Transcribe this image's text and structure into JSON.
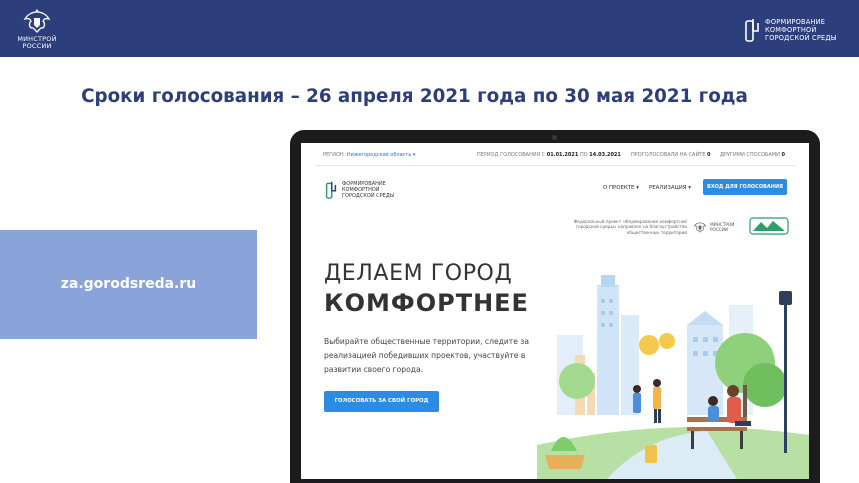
{
  "header": {
    "ministry_logo_lines": [
      "МИНСТРОЙ",
      "РОССИИ"
    ],
    "project_logo_lines": [
      "ФОРМИРОВАНИЕ",
      "КОМФОРТНОЙ",
      "ГОРОДСКОЙ СРЕДЫ"
    ]
  },
  "headline": "Сроки голосования – 26 апреля 2021 года по 30 мая 2021 года",
  "url_box": {
    "url": "za.gorodsreda.ru",
    "color": "#8aa3d9"
  },
  "site": {
    "region_label": "РЕГИОН",
    "region_value": "Нижегородская область",
    "period_label": "ПЕРИОД ГОЛОСОВАНИЯ С",
    "period_from": "01.01.2021",
    "period_to_label": "ПО",
    "period_to": "14.03.2021",
    "voted_label": "ПРОГОЛОСОВАЛИ НА САЙТЕ",
    "voted_value": "0",
    "others_label": "ДРУГИМИ СПОСОБАМИ",
    "others_value": "0",
    "logo_lines": [
      "ФОРМИРОВАНИЕ",
      "КОМФОРТНОЙ",
      "ГОРОДСКОЙ СРЕДЫ"
    ],
    "nav": [
      "О ПРОЕКТЕ",
      "РЕАЛИЗАЦИЯ"
    ],
    "login_button": "ВХОД ДЛЯ ГОЛОСОВАНИЯ",
    "federal_note": [
      "Федеральный проект «Формирование комфортной",
      "городской среды» направлен на благоустройство",
      "общественных территорий"
    ],
    "ministry_lines": [
      "МИНСТРОЙ",
      "РОССИИ"
    ],
    "hero_line1": "ДЕЛАЕМ ГОРОД",
    "hero_line2": "КОМФОРТНЕЕ",
    "description": "Выбирайте общественные территории, следите за реализацией победивших проектов, участвуйте в развитии своего города.",
    "cta_button": "ГОЛОСОВАТЬ ЗА СВОЙ ГОРОД"
  },
  "colors": {
    "brand_navy": "#2c3e7b",
    "site_blue": "#2c8be3",
    "site_green": "#2e9e6b"
  }
}
